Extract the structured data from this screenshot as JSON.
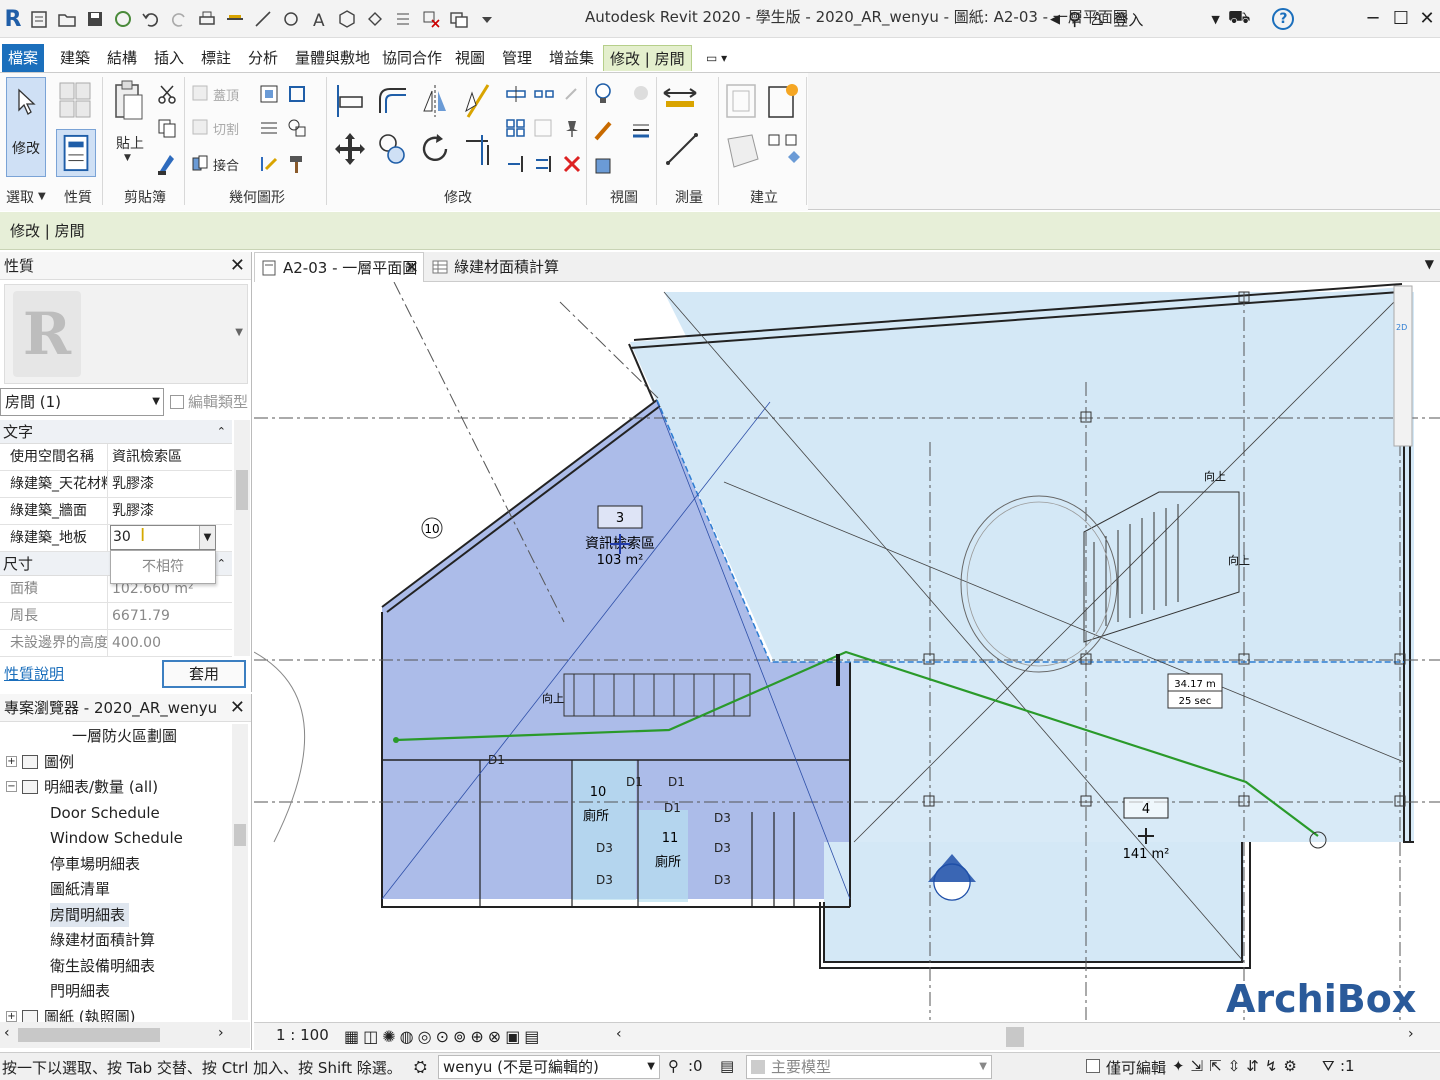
{
  "window": {
    "title": "Autodesk Revit 2020 - 學生版 - 2020_AR_wenyu - 圖紙: A2-03 - 一層平面圖",
    "sign_in": "登入"
  },
  "ribbon_tabs": [
    "檔案",
    "建築",
    "結構",
    "插入",
    "標註",
    "分析",
    "量體與敷地",
    "協同合作",
    "視圖",
    "管理",
    "增益集",
    "修改 | 房間"
  ],
  "ribbon": {
    "modify_label": "修改",
    "paste_label": "貼上",
    "cope_label": "蓋頂",
    "cut_label": "切割",
    "join_label": "接合",
    "panels": [
      "選取",
      "性質",
      "剪貼簿",
      "幾何圖形",
      "修改",
      "視圖",
      "測量",
      "建立"
    ]
  },
  "options_bar": {
    "text": "修改 | 房間"
  },
  "properties": {
    "title": "性質",
    "type_selector": "房間 (1)",
    "edit_type": "編輯類型",
    "group_text": "文字",
    "group_dims": "尺寸",
    "text_rows": [
      {
        "key": "使用空間名稱",
        "value": "資訊檢索區"
      },
      {
        "key": "綠建築_天花材料",
        "value": "乳膠漆"
      },
      {
        "key": "綠建築_牆面",
        "value": "乳膠漆"
      },
      {
        "key": "綠建築_地板",
        "value": "30"
      }
    ],
    "dropdown_option": "不相符",
    "dim_rows": [
      {
        "key": "面積",
        "value": "102.660 m²"
      },
      {
        "key": "周長",
        "value": "6671.79"
      },
      {
        "key": "未設邊界的高度",
        "value": "400.00"
      }
    ],
    "help": "性質說明",
    "apply": "套用"
  },
  "browser": {
    "title": "專案瀏覽器 - 2020_AR_wenyu",
    "items": [
      {
        "label": "一層防火區劃圖",
        "indent": 3
      },
      {
        "label": "圖例",
        "indent": 1
      },
      {
        "label": "明細表/數量 (all)",
        "indent": 1
      },
      {
        "label": "Door Schedule",
        "indent": 2
      },
      {
        "label": "Window Schedule",
        "indent": 2
      },
      {
        "label": "停車場明細表",
        "indent": 2
      },
      {
        "label": "圖紙清單",
        "indent": 2
      },
      {
        "label": "房間明細表",
        "indent": 2
      },
      {
        "label": "綠建材面積計算",
        "indent": 2
      },
      {
        "label": "衛生設備明細表",
        "indent": 2
      },
      {
        "label": "門明細表",
        "indent": 2
      },
      {
        "label": "圖紙 (執照圖)",
        "indent": 1
      }
    ],
    "selected_index": 7
  },
  "view_tabs": [
    {
      "label": "A2-03 - 一層平面圖",
      "active": true
    },
    {
      "label": "綠建材面積計算",
      "active": false
    }
  ],
  "drawing": {
    "room_a_number": "3",
    "room_a_name": "資訊檢索區",
    "room_a_area": "103 m²",
    "room_b_number": "4",
    "room_b_area": "141 m²",
    "room_10": "10",
    "room_11": "11",
    "toilet": "廁所",
    "path_distance": "34.17 m",
    "path_time": "25 sec",
    "stair_up": "向上",
    "door_d1": "D1",
    "door_d3": "D3",
    "grid_10": "10",
    "watermark": "ArchiBox"
  },
  "view_bar": {
    "scale": "1 : 100"
  },
  "status": {
    "hint": "按一下以選取、按 Tab 交替、按 Ctrl 加入、按 Shift 除選。",
    "workset": "wenyu (不是可編輯的)",
    "count": ":0",
    "model": "主要模型",
    "editable_only": "僅可編輯",
    "filter_count": ":1"
  },
  "colors": {
    "file_tab": "#1b6fbc",
    "contextual": "#e4efcd",
    "room_selected": "#a8b8e8",
    "room_fill": "#d4e8f6",
    "path": "#2a9a2a",
    "watermark": "#2a5a9a"
  }
}
